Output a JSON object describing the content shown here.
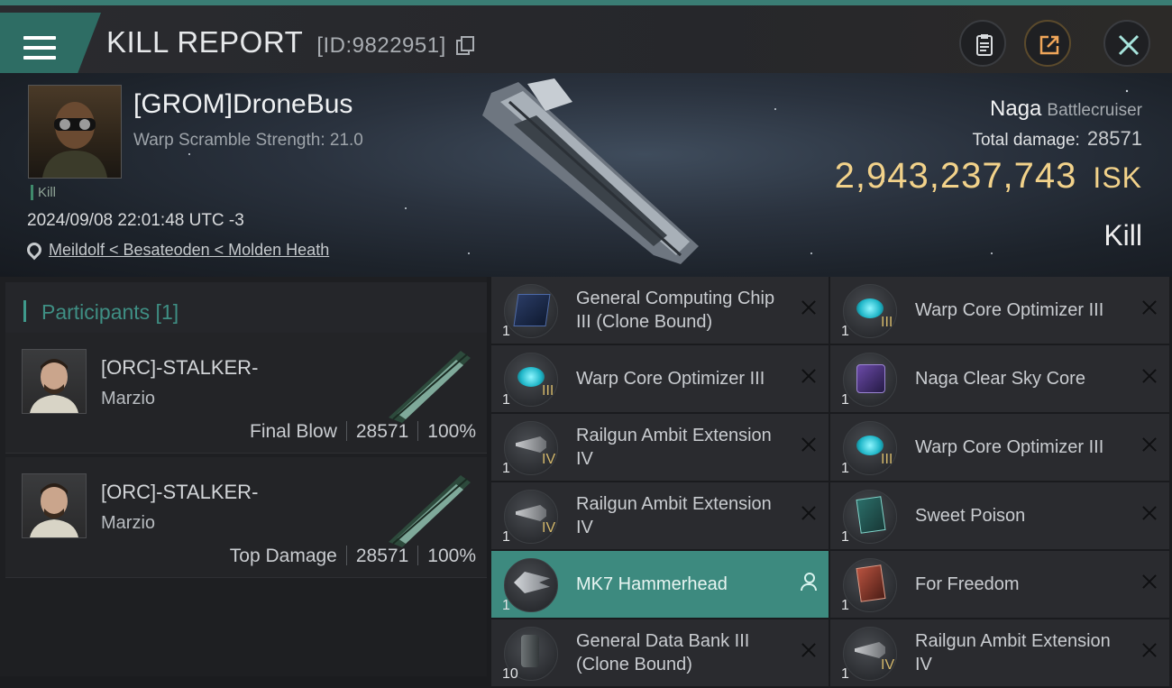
{
  "header": {
    "title": "KILL REPORT",
    "id_text": "[ID:9822951]",
    "buttons": [
      "clipboard",
      "share",
      "close"
    ]
  },
  "victim": {
    "pilot": "[GROM]DroneBus",
    "scramble": "Warp Scramble Strength: 21.0",
    "kill_tag": "Kill",
    "datetime": "2024/09/08 22:01:48 UTC -3",
    "location": "Meildolf < Besateoden < Molden Heath",
    "ship_name": "Naga",
    "ship_class": "Battlecruiser",
    "damage_label": "Total damage:",
    "damage_value": "28571",
    "isk_value": "2,943,237,743",
    "isk_unit": "ISK",
    "result": "Kill"
  },
  "participants": {
    "header": "Participants [1]",
    "rows": [
      {
        "name": "[ORC]-STALKER-",
        "corp": "Marzio",
        "role": "Final Blow",
        "damage": "28571",
        "percent": "100%"
      },
      {
        "name": "[ORC]-STALKER-",
        "corp": "Marzio",
        "role": "Top Damage",
        "damage": "28571",
        "percent": "100%"
      }
    ]
  },
  "items": {
    "left": [
      {
        "name": "General Computing Chip III (Clone Bound)",
        "qty": "1",
        "level": "",
        "icon": "chip-icon"
      },
      {
        "name": "Warp Core Optimizer III",
        "qty": "1",
        "level": "III",
        "icon": "warp-core-icon"
      },
      {
        "name": "Railgun Ambit Extension IV",
        "qty": "1",
        "level": "IV",
        "icon": "railgun-icon"
      },
      {
        "name": "Railgun Ambit Extension IV",
        "qty": "1",
        "level": "IV",
        "icon": "railgun-icon"
      },
      {
        "name": "MK7 Hammerhead",
        "qty": "1",
        "level": "",
        "icon": "drone-icon",
        "highlight": true
      },
      {
        "name": "General Data Bank III (Clone Bound)",
        "qty": "10",
        "level": "",
        "icon": "data-bank-icon"
      }
    ],
    "right": [
      {
        "name": "Warp Core Optimizer III",
        "qty": "1",
        "level": "III",
        "icon": "warp-core-icon"
      },
      {
        "name": "Naga Clear Sky Core",
        "qty": "1",
        "level": "",
        "icon": "core-cube-icon"
      },
      {
        "name": "Warp Core Optimizer III",
        "qty": "1",
        "level": "III",
        "icon": "warp-core-icon"
      },
      {
        "name": "Sweet Poison",
        "qty": "1",
        "level": "",
        "icon": "card-teal-icon"
      },
      {
        "name": "For Freedom",
        "qty": "1",
        "level": "",
        "icon": "card-red-icon"
      },
      {
        "name": "Railgun Ambit Extension IV",
        "qty": "1",
        "level": "IV",
        "icon": "railgun-icon"
      }
    ]
  }
}
